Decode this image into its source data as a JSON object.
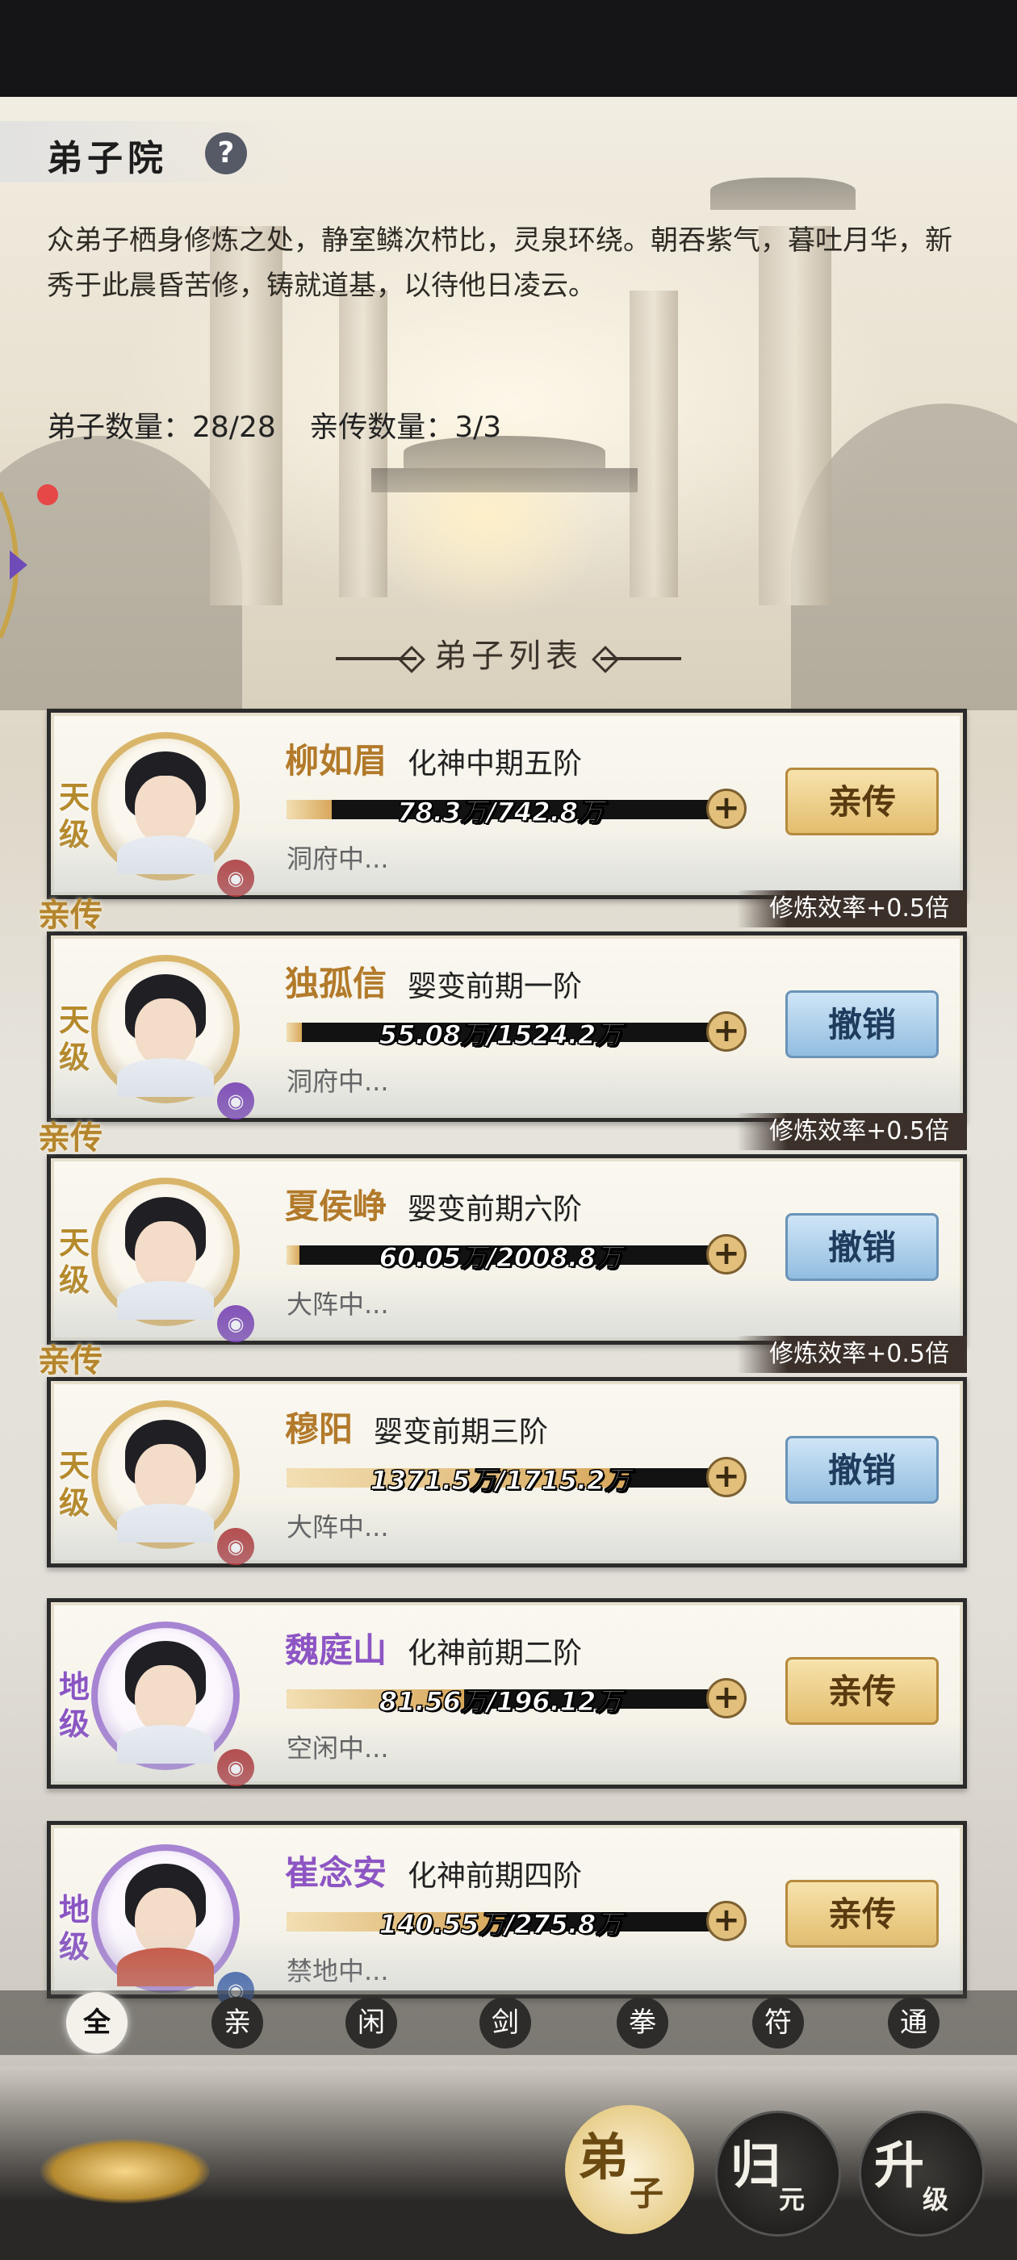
{
  "header": {
    "title": "弟子院",
    "help_icon": "?",
    "description": "众弟子栖身修炼之处，静室鳞次栉比，灵泉环绕。朝吞紫气，暮吐月华，新秀于此晨昏苦修，铸就道基，以待他日凌云。",
    "disciple_count": "弟子数量：28/28",
    "core_count": "亲传数量：3/3"
  },
  "list": {
    "header": "弟子列表",
    "disciples": [
      {
        "grade": "天级",
        "name": "柳如眉",
        "realm": "化神中期五阶",
        "progress_text": "78.3万/742.8万",
        "progress": 0.105,
        "status": "洞府中...",
        "button": "亲传",
        "tag": "",
        "effect": ""
      },
      {
        "grade": "天级",
        "name": "独孤信",
        "realm": "婴变前期一阶",
        "progress_text": "55.08万/1524.2万",
        "progress": 0.036,
        "status": "洞府中...",
        "button": "撤销",
        "tag": "亲传",
        "effect": "修炼效率+0.5倍"
      },
      {
        "grade": "天级",
        "name": "夏侯峥",
        "realm": "婴变前期六阶",
        "progress_text": "60.05万/2008.8万",
        "progress": 0.03,
        "status": "大阵中...",
        "button": "撤销",
        "tag": "亲传",
        "effect": "修炼效率+0.5倍"
      },
      {
        "grade": "天级",
        "name": "穆阳",
        "realm": "婴变前期三阶",
        "progress_text": "1371.5万/1715.2万",
        "progress": 0.8,
        "status": "大阵中...",
        "button": "撤销",
        "tag": "亲传",
        "effect": "修炼效率+0.5倍"
      },
      {
        "grade": "地级",
        "name": "魏庭山",
        "realm": "化神前期二阶",
        "progress_text": "81.56万/196.12万",
        "progress": 0.416,
        "status": "空闲中...",
        "button": "亲传",
        "tag": "",
        "effect": ""
      },
      {
        "grade": "地级",
        "name": "崔念安",
        "realm": "化神前期四阶",
        "progress_text": "140.55万/275.8万",
        "progress": 0.51,
        "status": "禁地中...",
        "button": "亲传",
        "tag": "",
        "effect": ""
      }
    ]
  },
  "filters": [
    "全",
    "亲",
    "闲",
    "剑",
    "拳",
    "符",
    "通"
  ],
  "bottom_nav": {
    "disciple": {
      "big": "弟",
      "small": "子"
    },
    "return": {
      "big": "归",
      "small": "元"
    },
    "upgrade": {
      "big": "升",
      "small": "级"
    }
  },
  "colors": {
    "gold_button": "#e3bd6d",
    "blue_button": "#92bde0",
    "heaven_grade": "#b58a2c",
    "earth_grade": "#8a55c2"
  }
}
